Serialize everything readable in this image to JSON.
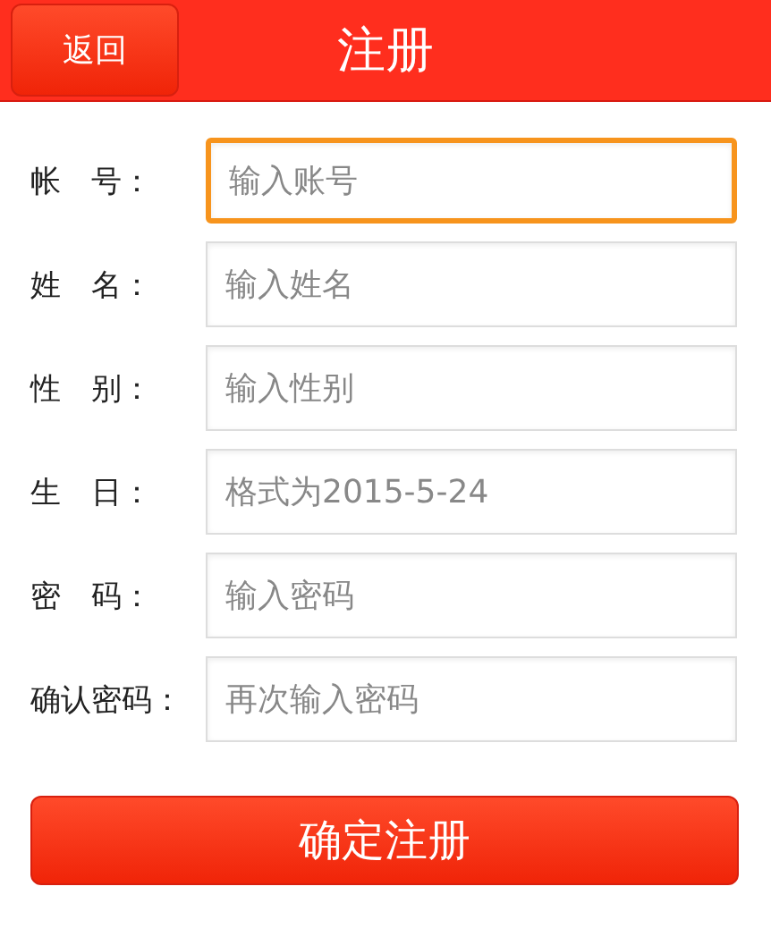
{
  "header": {
    "back_button": "返回",
    "title": "注册"
  },
  "fields": [
    {
      "label": "帐　号：",
      "placeholder": "输入账号",
      "focused": true
    },
    {
      "label": "姓　名：",
      "placeholder": "输入姓名",
      "focused": false
    },
    {
      "label": "性　别：",
      "placeholder": "输入性别",
      "focused": false
    },
    {
      "label": "生　日：",
      "placeholder": "格式为2015-5-24",
      "focused": false
    },
    {
      "label": "密　码：",
      "placeholder": "输入密码",
      "focused": false
    },
    {
      "label": "确认密码：",
      "placeholder": "再次输入密码",
      "focused": false
    }
  ],
  "submit_button": "确定注册"
}
